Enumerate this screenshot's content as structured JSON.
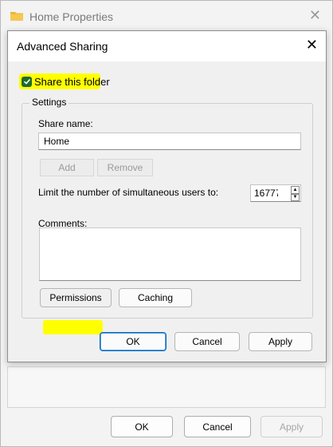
{
  "back_window": {
    "title": "Home Properties",
    "buttons": {
      "ok": "OK",
      "cancel": "Cancel",
      "apply": "Apply"
    }
  },
  "dialog": {
    "title": "Advanced Sharing",
    "share_checkbox": {
      "label": "Share this folder",
      "checked": true
    },
    "settings": {
      "group_label": "Settings",
      "share_name_label": "Share name:",
      "share_name_value": "Home",
      "add_button": "Add",
      "remove_button": "Remove",
      "limit_label": "Limit the number of simultaneous users to:",
      "limit_value": "16777",
      "comments_label": "Comments:",
      "comments_value": "",
      "permissions_button": "Permissions",
      "caching_button": "Caching"
    },
    "buttons": {
      "ok": "OK",
      "cancel": "Cancel",
      "apply": "Apply"
    }
  },
  "colors": {
    "highlight": "#ffff00",
    "checkbox_fill": "#1e6b2e",
    "primary_border": "#0067c0"
  }
}
